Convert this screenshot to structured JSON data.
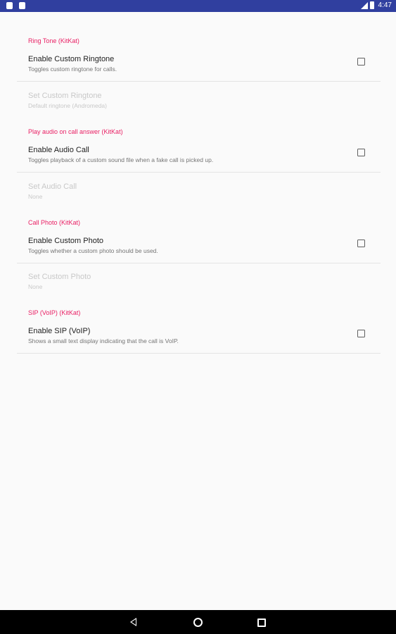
{
  "status_bar": {
    "time": "4:47"
  },
  "sections": [
    {
      "header": "Ring Tone (KitKat)",
      "enable": {
        "title": "Enable Custom Ringtone",
        "summary": "Toggles custom ringtone for calls.",
        "checked": false
      },
      "setting": {
        "title": "Set Custom Ringtone",
        "summary": "Default ringtone (Andromeda)",
        "enabled": false
      }
    },
    {
      "header": "Play audio on call answer (KitKat)",
      "enable": {
        "title": "Enable Audio Call",
        "summary": "Toggles playback of a custom sound file when a fake call is picked up.",
        "checked": false
      },
      "setting": {
        "title": "Set Audio Call",
        "summary": "None",
        "enabled": false
      }
    },
    {
      "header": "Call Photo (KitKat)",
      "enable": {
        "title": "Enable Custom Photo",
        "summary": "Toggles whether a custom photo should be used.",
        "checked": false
      },
      "setting": {
        "title": "Set Custom Photo",
        "summary": "None",
        "enabled": false
      }
    },
    {
      "header": "SIP (VoIP) (KitKat)",
      "enable": {
        "title": "Enable SIP (VoIP)",
        "summary": "Shows a small text display indicating that the call is VoIP.",
        "checked": false
      }
    }
  ],
  "colors": {
    "status_bar": "#303f9f",
    "category_accent": "#e91e63",
    "background": "#fafafa",
    "nav_bar": "#000000"
  },
  "icons": {
    "status_left": [
      "sd-card-icon",
      "notification-icon"
    ],
    "status_right": [
      "no-signal-icon",
      "battery-icon"
    ],
    "nav": [
      "back-icon",
      "home-icon",
      "recents-icon"
    ]
  }
}
